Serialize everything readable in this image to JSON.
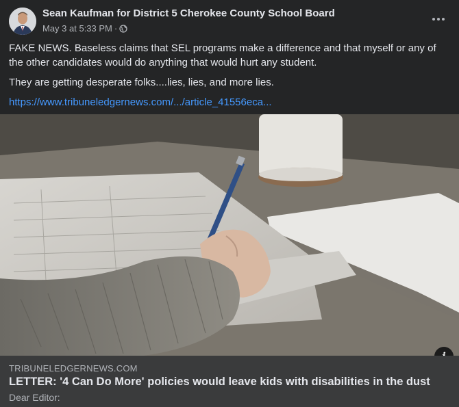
{
  "post": {
    "author": "Sean Kaufman for District 5 Cherokee County School Board",
    "timestamp": "May 3 at 5:33 PM",
    "separator": "·",
    "audience_icon": "globe-icon",
    "more_icon": "more-options-icon",
    "text": {
      "paragraph1": "FAKE NEWS.   Baseless claims that SEL programs make a difference and that myself or any of the other candidates would do anything that would hurt any student.",
      "paragraph2": "They are getting desperate folks....lies, lies, and more lies.",
      "link": "https://www.tribuneledgernews.com/.../article_41556eca..."
    }
  },
  "link_preview": {
    "domain": "TRIBUNELEDGERNEWS.COM",
    "headline": "LETTER: '4 Can Do More' policies would leave kids with disabilities in the dust",
    "description": "Dear Editor:",
    "info_icon": "info-icon",
    "info_glyph": "i"
  },
  "colors": {
    "background": "#242526",
    "preview_background": "#3a3b3c",
    "link": "#4599ff",
    "primary_text": "#e4e6eb",
    "secondary_text": "#b0b3b8"
  }
}
